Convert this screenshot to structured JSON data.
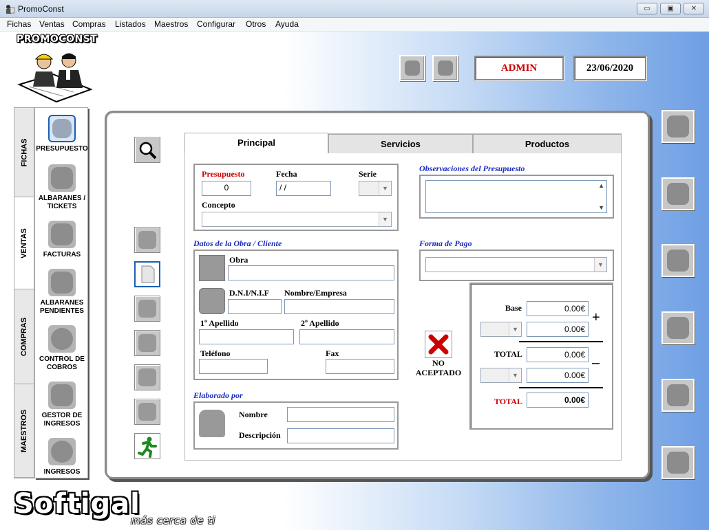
{
  "window": {
    "title": "PromoConst",
    "minimize": "▭",
    "maximize": "▣",
    "close": "✕"
  },
  "menu": [
    "Fichas",
    "Ventas",
    "Compras",
    "Listados",
    "Maestros",
    "Configurar",
    "Otros",
    "Ayuda"
  ],
  "header": {
    "logo": "PROMOCONST",
    "user": "ADMIN",
    "date": "23/06/2020"
  },
  "vtabs": [
    "FICHAS",
    "VENTAS",
    "COMPRAS",
    "MAESTROS"
  ],
  "side_items": [
    {
      "label": "PRESUPUESTO",
      "icon": "budget-icon"
    },
    {
      "label": "ALBARANES / TICKETS",
      "icon": "delivery-note-icon"
    },
    {
      "label": "FACTURAS",
      "icon": "invoice-icon"
    },
    {
      "label": "ALBARANES PENDIENTES",
      "icon": "pending-note-icon"
    },
    {
      "label": "CONTROL DE COBROS",
      "icon": "payments-icon"
    },
    {
      "label": "GESTOR DE INGRESOS",
      "icon": "income-manager-icon"
    },
    {
      "label": "INGRESOS",
      "icon": "income-icon"
    }
  ],
  "tabs": [
    "Principal",
    "Servicios",
    "Productos"
  ],
  "form": {
    "presupuesto_label": "Presupuesto",
    "presupuesto_value": "0",
    "fecha_label": "Fecha",
    "fecha_value": " /  /",
    "serie_label": "Serie",
    "concepto_label": "Concepto",
    "observaciones_label": "Observaciones del Presupuesto",
    "datos_label": "Datos de la Obra / Cliente",
    "obra_label": "Obra",
    "dni_label": "D.N.I/N.I.F",
    "nombre_empresa_label": "Nombre/Empresa",
    "apellido1_label": "1º Apellido",
    "apellido2_label": "2º Apellido",
    "telefono_label": "Teléfono",
    "fax_label": "Fax",
    "forma_pago_label": "Forma de Pago",
    "elaborado_label": "Elaborado por",
    "nombre_label": "Nombre",
    "descripcion_label": "Descripción",
    "status": "NO ACEPTADO"
  },
  "totals": {
    "base_label": "Base",
    "base": "0.00€",
    "tax": "0.00€",
    "total_label": "TOTAL",
    "total": "0.00€",
    "ret": "0.00€",
    "final_label": "TOTAL",
    "final": "0.00€",
    "plus": "+",
    "minus": "–"
  },
  "footer": {
    "brand": "Softigal",
    "slogan": "más cerca de ti"
  },
  "colors": {
    "label_red": "#cc0000",
    "section_blue": "#1a2bbf",
    "accent": "#1a5fb4"
  }
}
